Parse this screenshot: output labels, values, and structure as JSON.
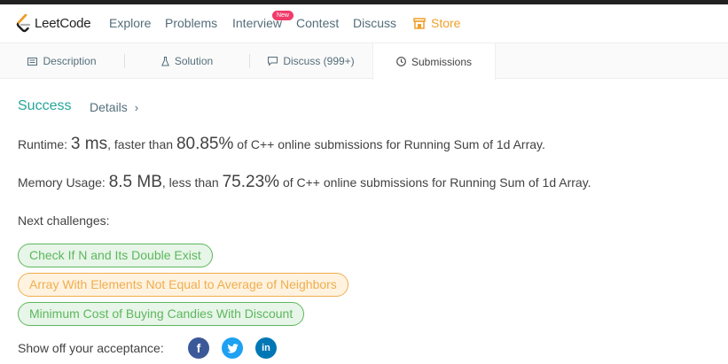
{
  "navbar": {
    "logo_text": "LeetCode",
    "items": [
      "Explore",
      "Problems",
      "Interview",
      "Contest",
      "Discuss"
    ],
    "store_label": "Store",
    "new_badge": "New",
    "colors": {
      "store": "#f0a02a",
      "badge": "#f03c6b"
    }
  },
  "tabs": [
    {
      "label": "Description",
      "icon": "description-icon"
    },
    {
      "label": "Solution",
      "icon": "flask-icon"
    },
    {
      "label": "Discuss (999+)",
      "icon": "discuss-icon"
    },
    {
      "label": "Submissions",
      "icon": "clock-icon",
      "active": true
    }
  ],
  "result": {
    "status": "Success",
    "details_label": "Details",
    "details_chevron": "›",
    "status_color": "#26a69a"
  },
  "runtime": {
    "label": "Runtime: ",
    "value": "3 ms",
    "comparison": ", faster than ",
    "percent": "80.85%",
    "suffix": " of C++ online submissions for Running Sum of 1d Array."
  },
  "memory": {
    "label": "Memory Usage: ",
    "value": "8.5 MB",
    "comparison": ", less than ",
    "percent": "75.23%",
    "suffix": " of C++ online submissions for Running Sum of 1d Array."
  },
  "next_challenges": {
    "label": "Next challenges:",
    "items": [
      {
        "title": "Check If N and Its Double Exist",
        "difficulty_color": "green"
      },
      {
        "title": "Array With Elements Not Equal to Average of Neighbors",
        "difficulty_color": "orange"
      },
      {
        "title": "Minimum Cost of Buying Candies With Discount",
        "difficulty_color": "green"
      }
    ]
  },
  "share": {
    "label": "Show off your acceptance:",
    "icons": [
      {
        "name": "facebook-icon",
        "glyph": "f",
        "color": "#3b5998"
      },
      {
        "name": "twitter-icon",
        "glyph": "t",
        "color": "#1da1f2"
      },
      {
        "name": "linkedin-icon",
        "glyph": "in",
        "color": "#0077b5"
      }
    ]
  }
}
